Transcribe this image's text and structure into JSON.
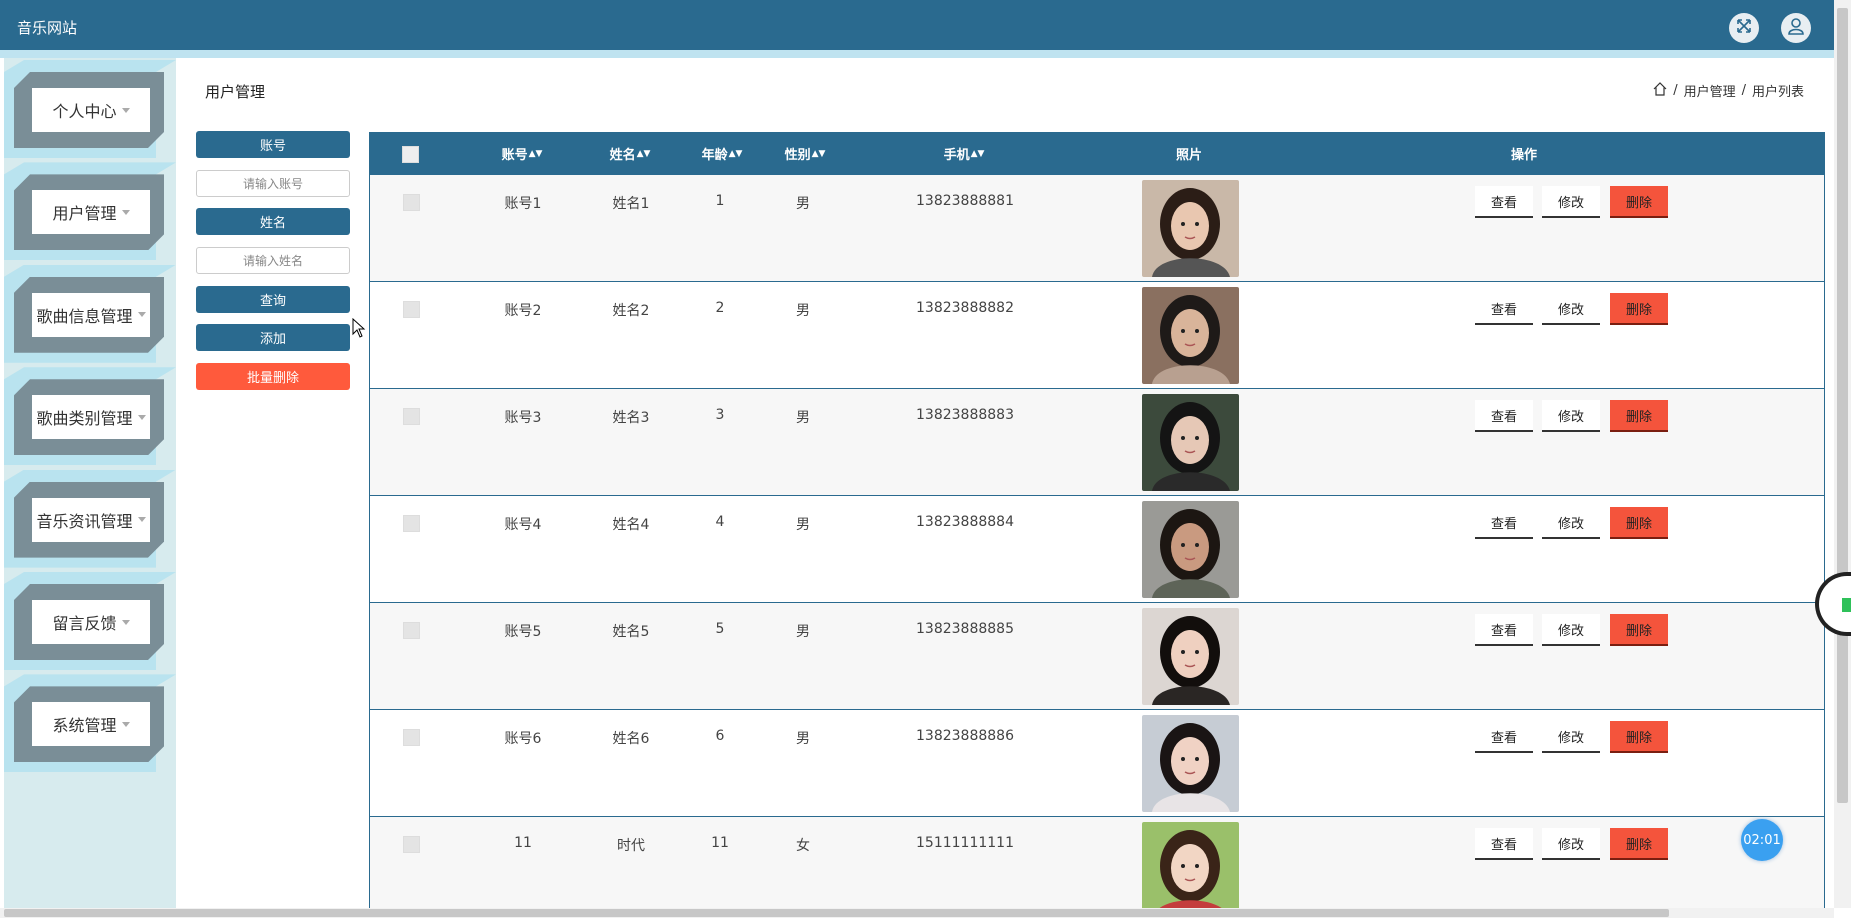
{
  "header": {
    "site_title": "音乐网站",
    "fullscreen_icon": "expand-icon",
    "user_icon": "user-icon"
  },
  "colors": {
    "primary": "#2a6a8f",
    "danger": "#f4543c",
    "batch_delete": "#ff5a3c",
    "sidebar_bg": "#d7ebee"
  },
  "sidebar": {
    "items": [
      {
        "label": "个人中心"
      },
      {
        "label": "用户管理"
      },
      {
        "label": "歌曲信息管理"
      },
      {
        "label": "歌曲类别管理"
      },
      {
        "label": "音乐资讯管理"
      },
      {
        "label": "留言反馈"
      },
      {
        "label": "系统管理"
      }
    ]
  },
  "page": {
    "title": "用户管理"
  },
  "breadcrumb": {
    "icon": "home-icon",
    "items": [
      "用户管理",
      "用户列表"
    ],
    "separator": "/"
  },
  "search": {
    "account_label": "账号",
    "account_placeholder": "请输入账号",
    "name_label": "姓名",
    "name_placeholder": "请输入姓名",
    "query_button": "查询",
    "add_button": "添加",
    "batch_delete_button": "批量删除"
  },
  "table": {
    "headers": {
      "account": "账号",
      "name": "姓名",
      "age": "年龄",
      "gender": "性别",
      "phone": "手机",
      "photo": "照片",
      "actions": "操作"
    },
    "action_labels": {
      "view": "查看",
      "edit": "修改",
      "delete": "删除"
    },
    "rows": [
      {
        "account": "账号1",
        "name": "姓名1",
        "age": "1",
        "gender": "男",
        "phone": "13823888881"
      },
      {
        "account": "账号2",
        "name": "姓名2",
        "age": "2",
        "gender": "男",
        "phone": "13823888882"
      },
      {
        "account": "账号3",
        "name": "姓名3",
        "age": "3",
        "gender": "男",
        "phone": "13823888883"
      },
      {
        "account": "账号4",
        "name": "姓名4",
        "age": "4",
        "gender": "男",
        "phone": "13823888884"
      },
      {
        "account": "账号5",
        "name": "姓名5",
        "age": "5",
        "gender": "男",
        "phone": "13823888885"
      },
      {
        "account": "账号6",
        "name": "姓名6",
        "age": "6",
        "gender": "男",
        "phone": "13823888886"
      },
      {
        "account": "11",
        "name": "时代",
        "age": "11",
        "gender": "女",
        "phone": "15111111111"
      }
    ]
  },
  "timer": {
    "value": "02:01"
  }
}
